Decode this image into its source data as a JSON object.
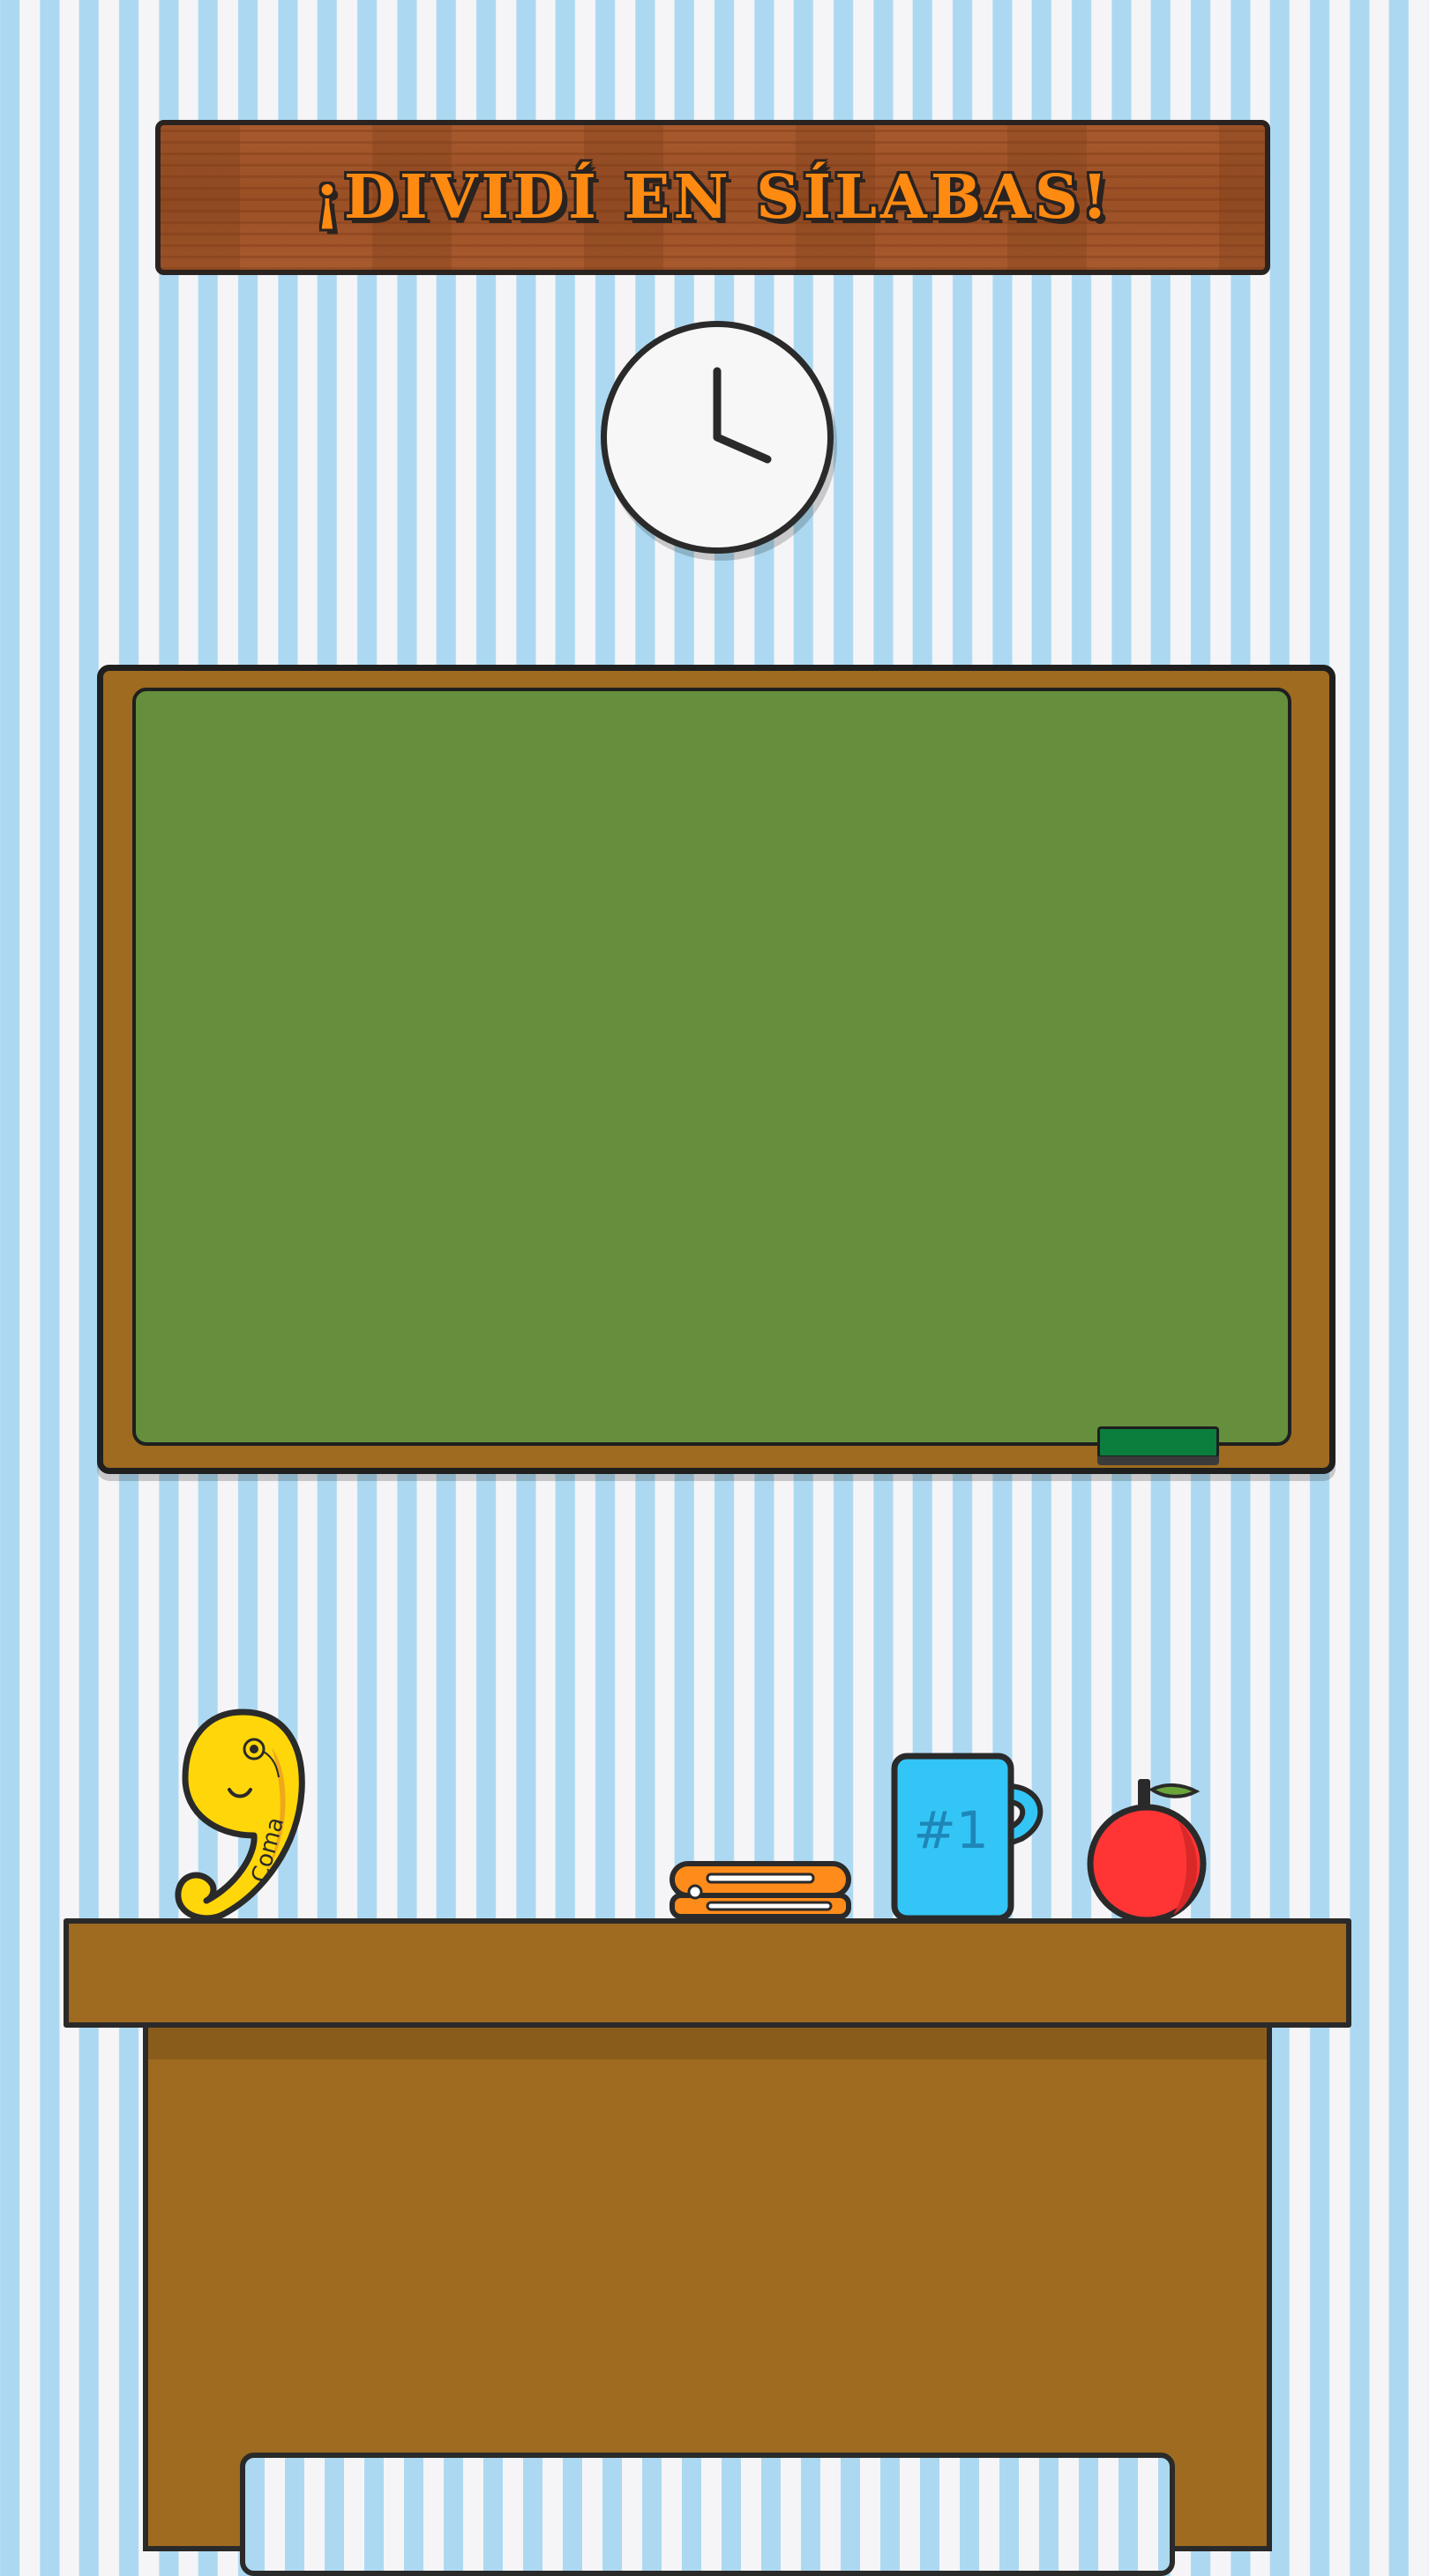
{
  "header": {
    "title": "¡DIVIDÍ EN SÍLABAS!"
  },
  "clock": {
    "icon": "clock-icon",
    "hour": 4,
    "minute": 0
  },
  "chalkboard": {
    "content": ""
  },
  "props": {
    "mascot": {
      "icon": "comma-mascot-icon",
      "label": "Coma"
    },
    "stapler": {
      "icon": "stapler-icon"
    },
    "mug": {
      "icon": "mug-icon",
      "label": "#1"
    },
    "apple": {
      "icon": "apple-icon"
    }
  },
  "colors": {
    "title_text": "#ff8a12",
    "sign_wood": "#a85a2e",
    "chalkboard": "#658f3c",
    "frame_wood": "#9e6b20",
    "stripe_blue": "#acd9f1",
    "stripe_white": "#f5f5f7",
    "mascot_yellow": "#ffd60a",
    "stapler_orange": "#ff8c1a",
    "mug_blue": "#33c5f5",
    "apple_red": "#ff3535"
  }
}
